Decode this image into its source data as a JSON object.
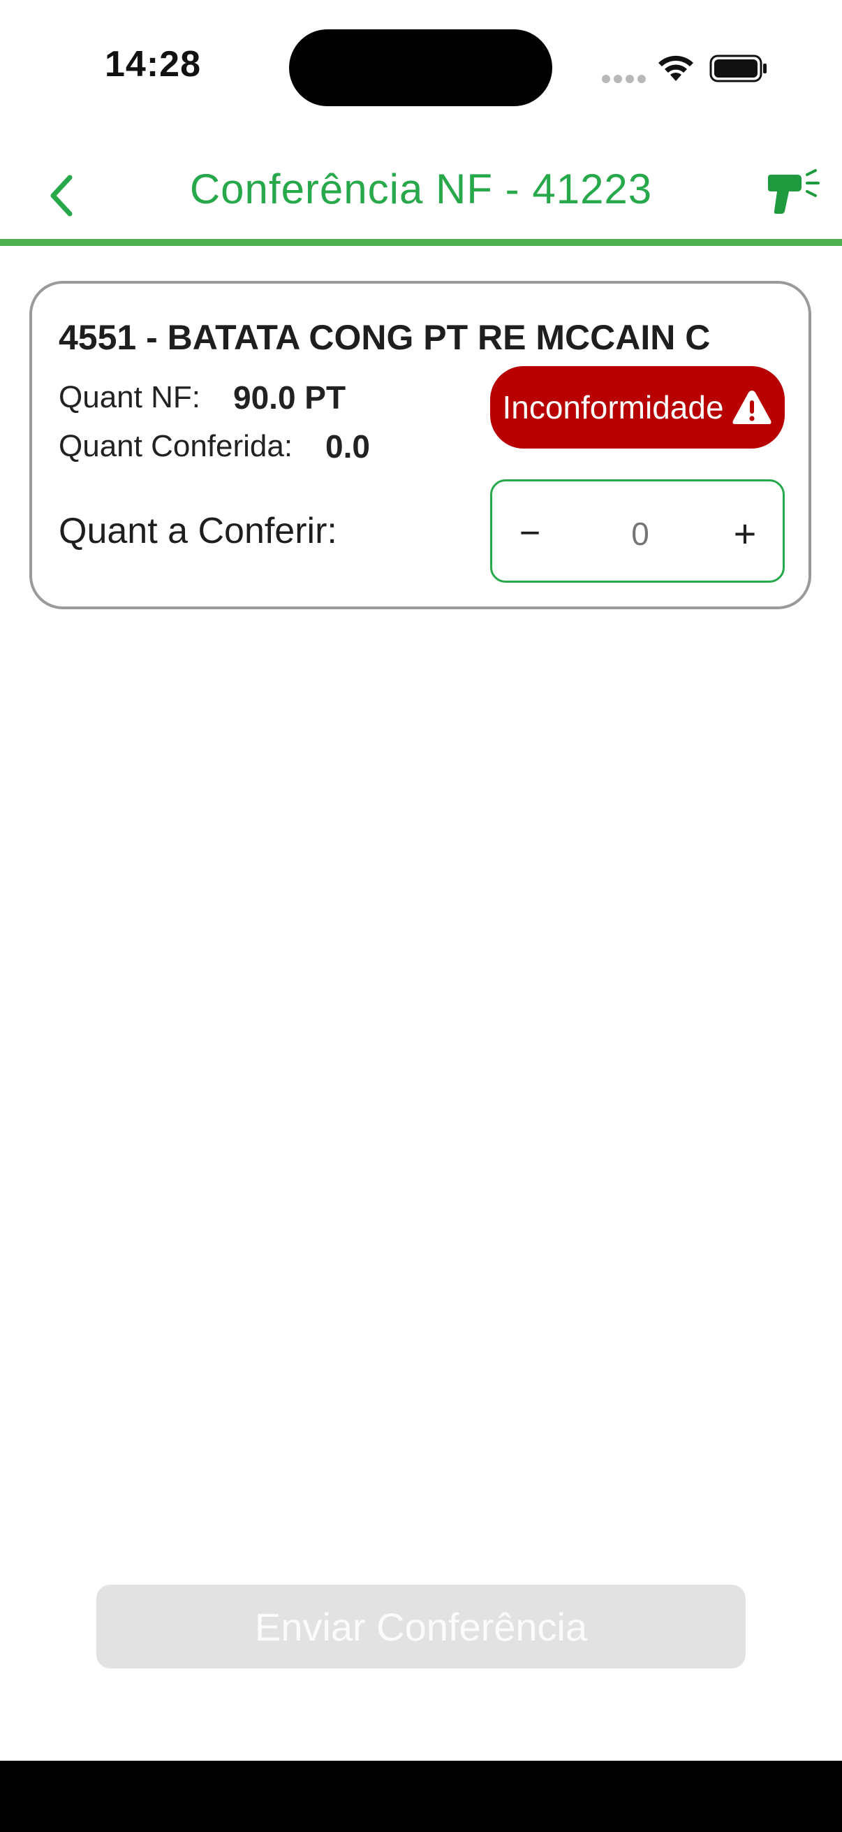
{
  "status_bar": {
    "time": "14:28"
  },
  "header": {
    "title": "Conferência NF - 41223",
    "back_icon": "chevron-left-icon",
    "scanner_icon": "barcode-scanner-icon"
  },
  "item": {
    "title": "4551 - BATATA CONG PT RE MCCAIN C",
    "qty_nf_label": "Quant NF:",
    "qty_nf_value": "90.0 PT",
    "qty_checked_label": "Quant Conferida:",
    "qty_checked_value": "0.0",
    "nonconformity_label": "Inconformidade",
    "nonconformity_icon": "warning-icon",
    "qty_to_check_label": "Quant a Conferir:",
    "stepper": {
      "minus": "−",
      "plus": "+",
      "placeholder": "0"
    }
  },
  "footer": {
    "send_label": "Enviar Conferência"
  },
  "colors": {
    "accent": "#27a84a",
    "divider": "#4caf50",
    "danger": "#b80000",
    "disabled": "#e2e2e2"
  }
}
